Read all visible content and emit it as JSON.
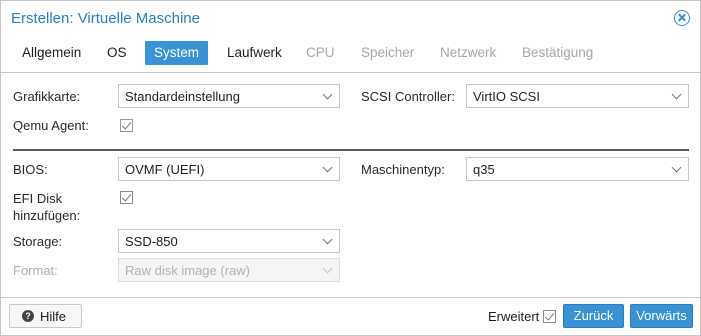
{
  "window": {
    "title": "Erstellen: Virtuelle Maschine"
  },
  "tabs": [
    {
      "label": "Allgemein",
      "state": "normal"
    },
    {
      "label": "OS",
      "state": "normal"
    },
    {
      "label": "System",
      "state": "active"
    },
    {
      "label": "Laufwerk",
      "state": "normal"
    },
    {
      "label": "CPU",
      "state": "disabled"
    },
    {
      "label": "Speicher",
      "state": "disabled"
    },
    {
      "label": "Netzwerk",
      "state": "disabled"
    },
    {
      "label": "Bestätigung",
      "state": "disabled"
    }
  ],
  "form": {
    "grafikkarte": {
      "label": "Grafikkarte:",
      "value": "Standardeinstellung"
    },
    "scsi": {
      "label": "SCSI Controller:",
      "value": "VirtIO SCSI"
    },
    "qemu_agent": {
      "label": "Qemu Agent:",
      "checked": false
    },
    "bios": {
      "label": "BIOS:",
      "value": "OVMF (UEFI)"
    },
    "maschinentyp": {
      "label": "Maschinentyp:",
      "value": "q35"
    },
    "efi_disk": {
      "label_line1": "EFI Disk",
      "label_line2": "hinzufügen:",
      "checked": true
    },
    "storage": {
      "label": "Storage:",
      "value": "SSD-850"
    },
    "format": {
      "label": "Format:",
      "value": "Raw disk image (raw)",
      "disabled": true
    }
  },
  "footer": {
    "help_label": "Hilfe",
    "advanced_label": "Erweitert",
    "advanced_checked": true,
    "back_label": "Zurück",
    "next_label": "Vorwärts"
  },
  "colors": {
    "accent": "#3892d4",
    "title": "#2b7fc8"
  }
}
